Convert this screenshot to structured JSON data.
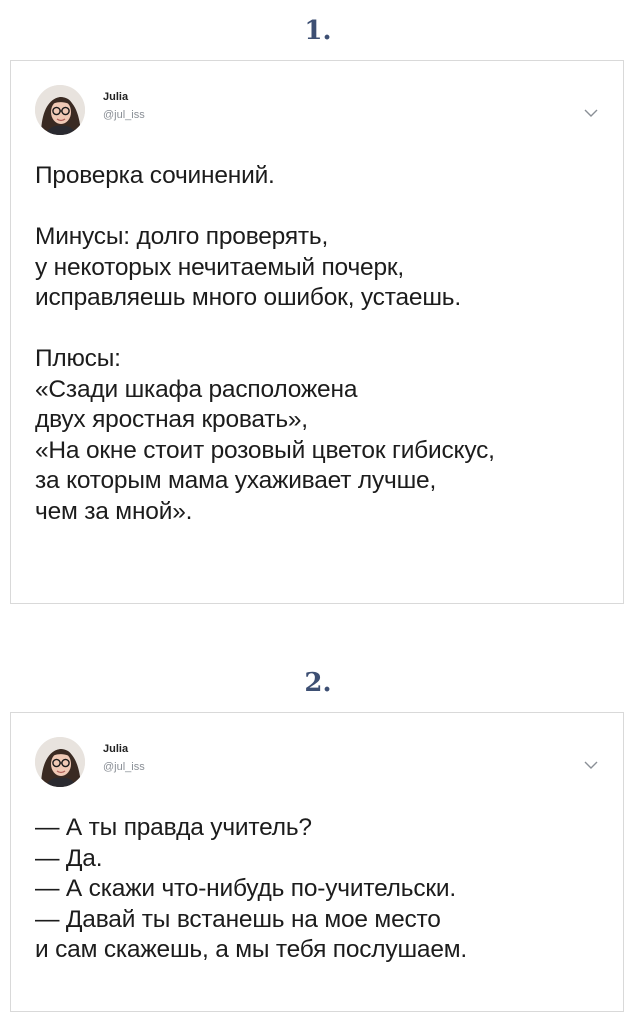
{
  "sections": [
    {
      "number": "1.",
      "tweet": {
        "author_name": "Julia",
        "author_handle": "@jul_iss",
        "paragraphs": [
          [
            "Проверка сочинений."
          ],
          [
            "Минусы: долго проверять,",
            "у некоторых нечитаемый почерк,",
            "исправляешь много ошибок, устаешь."
          ],
          [
            "Плюсы:",
            "«Сзади шкафа расположена",
            "двух яростная кровать»,",
            "«На окне стоит розовый цветок гибискус,",
            "за которым мама ухаживает лучше,",
            "чем за мной»."
          ]
        ]
      }
    },
    {
      "number": "2.",
      "tweet": {
        "author_name": "Julia",
        "author_handle": "@jul_iss",
        "paragraphs": [
          [
            "— А ты правда учитель?",
            "— Да.",
            "— А скажи что-нибудь по-учительски.",
            "— Давай ты встанешь на мое место",
            "и сам скажешь, а мы тебя послушаем."
          ]
        ]
      }
    }
  ],
  "icons": {
    "menu": "chevron-down-icon",
    "avatar": "avatar"
  },
  "colors": {
    "number": "#3d4f73",
    "border": "#d9d9d9",
    "handle": "#8a8f96"
  }
}
